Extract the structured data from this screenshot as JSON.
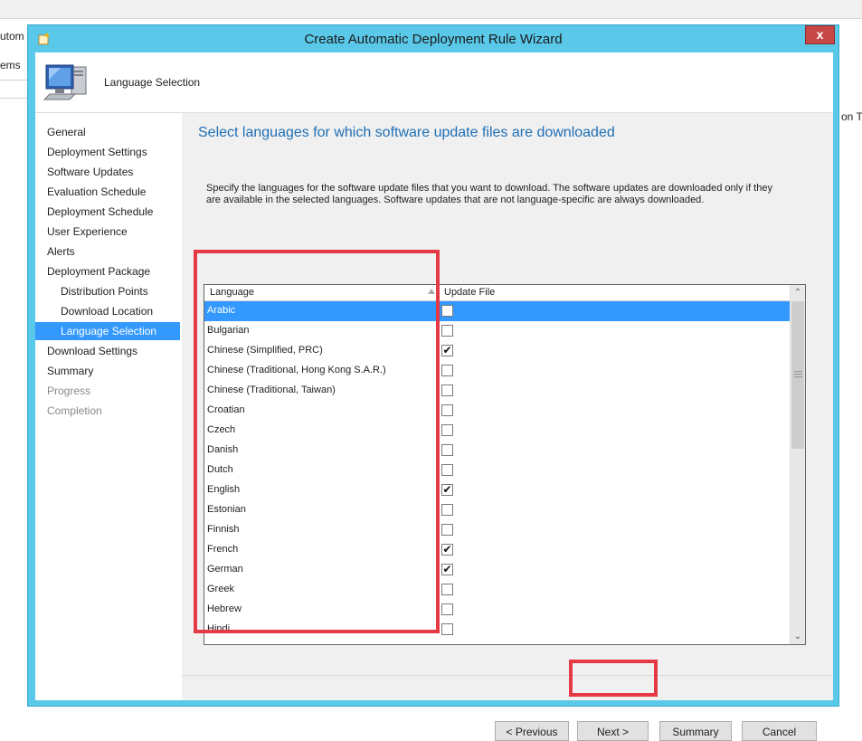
{
  "background": {
    "frag_left_top": "utom",
    "frag_left_mid": "ems",
    "frag_right": "on T"
  },
  "window": {
    "title": "Create Automatic Deployment Rule Wizard",
    "close_label": "x"
  },
  "header": {
    "title": "Language Selection",
    "icon": "computer-icon"
  },
  "nav": {
    "items": [
      {
        "label": "General",
        "state": "normal"
      },
      {
        "label": "Deployment Settings",
        "state": "normal"
      },
      {
        "label": "Software Updates",
        "state": "normal"
      },
      {
        "label": "Evaluation Schedule",
        "state": "normal"
      },
      {
        "label": "Deployment Schedule",
        "state": "normal"
      },
      {
        "label": "User Experience",
        "state": "normal"
      },
      {
        "label": "Alerts",
        "state": "normal"
      },
      {
        "label": "Deployment Package",
        "state": "normal"
      },
      {
        "label": "Distribution Points",
        "state": "sub"
      },
      {
        "label": "Download Location",
        "state": "sub"
      },
      {
        "label": "Language Selection",
        "state": "sub-active"
      },
      {
        "label": "Download Settings",
        "state": "normal"
      },
      {
        "label": "Summary",
        "state": "normal"
      },
      {
        "label": "Progress",
        "state": "disabled"
      },
      {
        "label": "Completion",
        "state": "disabled"
      }
    ]
  },
  "main": {
    "heading": "Select languages for which software update files are downloaded",
    "description": "Specify the languages for the software update files that you want to download. The software updates are downloaded only if they are available in the selected languages. Software updates that are not language-specific are always downloaded.",
    "grid": {
      "col_language": "Language",
      "col_update": "Update File",
      "rows": [
        {
          "language": "Arabic",
          "checked": false,
          "selected": true
        },
        {
          "language": "Bulgarian",
          "checked": false,
          "selected": false
        },
        {
          "language": "Chinese (Simplified, PRC)",
          "checked": true,
          "selected": false
        },
        {
          "language": "Chinese (Traditional, Hong Kong S.A.R.)",
          "checked": false,
          "selected": false
        },
        {
          "language": "Chinese (Traditional, Taiwan)",
          "checked": false,
          "selected": false
        },
        {
          "language": "Croatian",
          "checked": false,
          "selected": false
        },
        {
          "language": "Czech",
          "checked": false,
          "selected": false
        },
        {
          "language": "Danish",
          "checked": false,
          "selected": false
        },
        {
          "language": "Dutch",
          "checked": false,
          "selected": false
        },
        {
          "language": "English",
          "checked": true,
          "selected": false
        },
        {
          "language": "Estonian",
          "checked": false,
          "selected": false
        },
        {
          "language": "Finnish",
          "checked": false,
          "selected": false
        },
        {
          "language": "French",
          "checked": true,
          "selected": false
        },
        {
          "language": "German",
          "checked": true,
          "selected": false
        },
        {
          "language": "Greek",
          "checked": false,
          "selected": false
        },
        {
          "language": "Hebrew",
          "checked": false,
          "selected": false
        },
        {
          "language": "Hindi",
          "checked": false,
          "selected": false
        }
      ]
    }
  },
  "buttons": {
    "previous": "< Previous",
    "next": "Next >",
    "summary": "Summary",
    "cancel": "Cancel"
  },
  "colors": {
    "accent": "#3399ff",
    "title_bar": "#5ac8e8",
    "heading": "#1f6fb5",
    "highlight": "#e63946"
  }
}
